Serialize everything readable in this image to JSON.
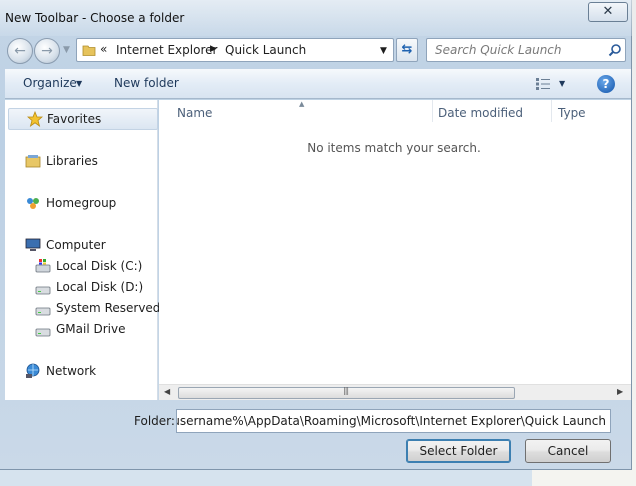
{
  "window": {
    "title": "New Toolbar - Choose a folder",
    "close_glyph": "✕"
  },
  "address": {
    "chevron": "«",
    "crumbs": [
      "Internet Explorer",
      "Quick Launch"
    ],
    "crumb_separator": "▶",
    "dropdown_glyph": "▼"
  },
  "search": {
    "placeholder": "Search Quick Launch"
  },
  "toolbar": {
    "organize_label": "Organize",
    "new_folder_label": "New folder",
    "dropdown_glyph": "▼",
    "help_glyph": "?"
  },
  "nav": {
    "favorites": "Favorites",
    "libraries": "Libraries",
    "homegroup": "Homegroup",
    "computer": "Computer",
    "drives": [
      "Local Disk (C:)",
      "Local Disk (D:)",
      "System Reserved (F",
      "GMail Drive"
    ],
    "network": "Network"
  },
  "columns": [
    "Name",
    "Date modified",
    "Type"
  ],
  "content": {
    "empty_message": "No items match your search."
  },
  "folder": {
    "label": "Folder:",
    "value": "C:\\Users\\%username%\\AppData\\Roaming\\Microsoft\\Internet Explorer\\Quick Launch"
  },
  "buttons": {
    "select_folder": "Select Folder",
    "cancel": "Cancel"
  },
  "colors": {
    "accent": "#1e62b0",
    "toolbar_text": "#1e395b"
  },
  "icons": [
    "star-icon",
    "libraries-icon",
    "homegroup-icon",
    "computer-icon",
    "drive-icon",
    "network-icon",
    "search-icon",
    "folder-icon",
    "help-icon",
    "views-icon",
    "refresh-icon"
  ]
}
